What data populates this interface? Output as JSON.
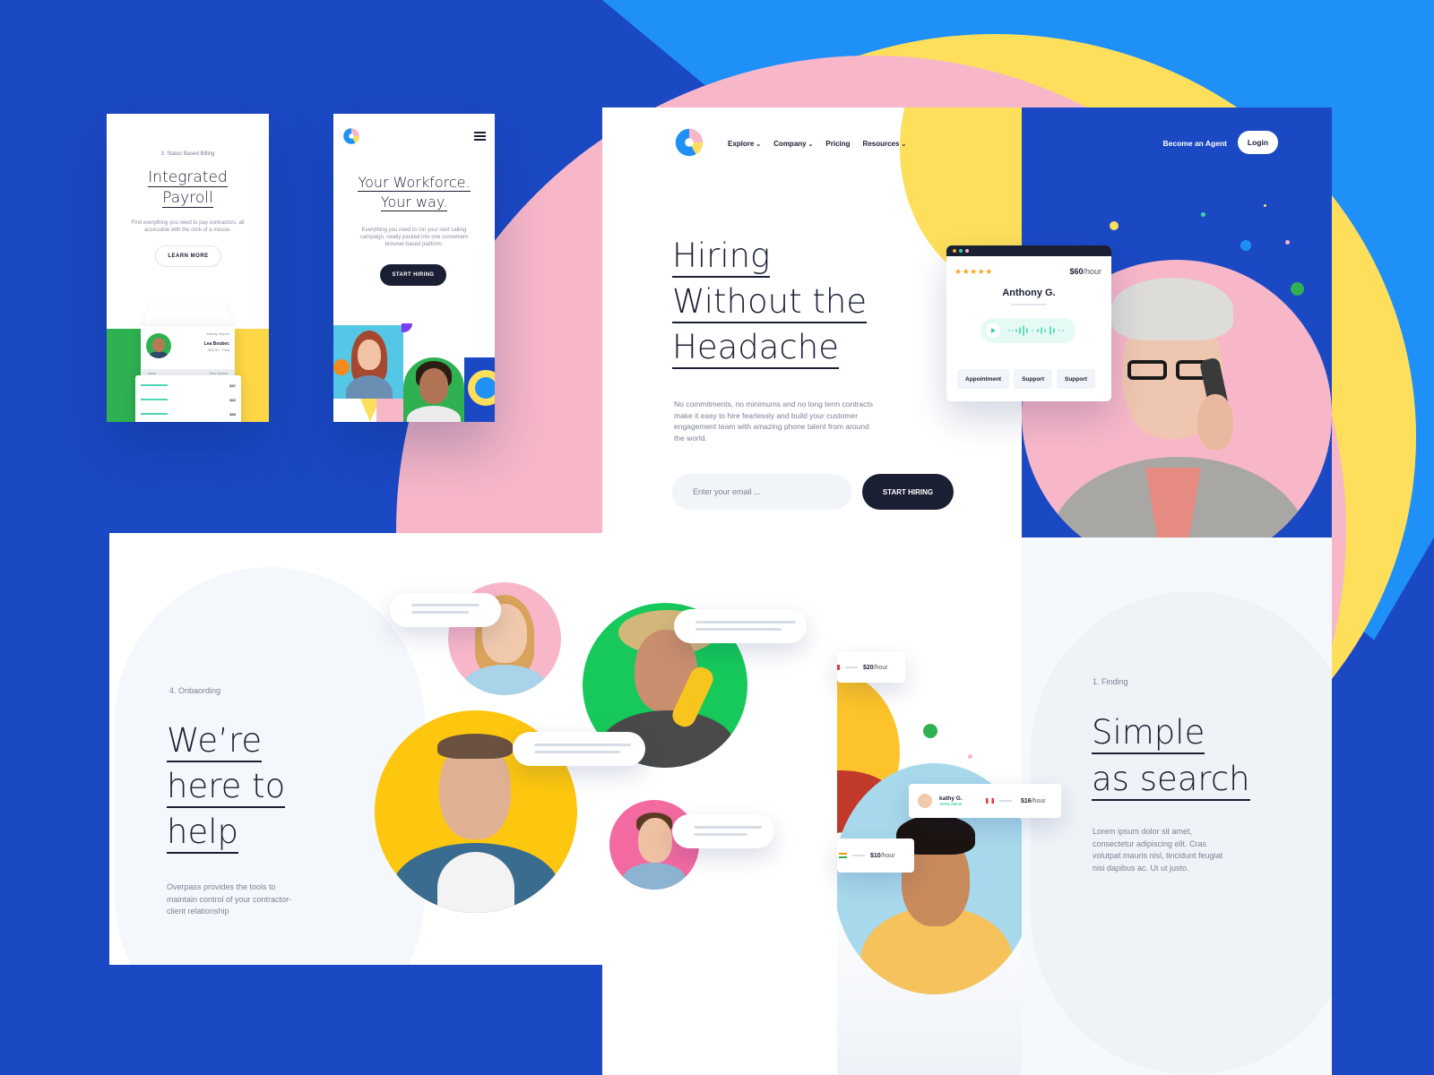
{
  "colors": {
    "brand_blue": "#1b49c4",
    "light_blue": "#1e88f5",
    "pink": "#f7b7c9",
    "yellow": "#fddf5b",
    "dark": "#1a1f33",
    "mint": "#3cd3a8"
  },
  "mobile_payroll": {
    "step": "3. Status Based Billing",
    "title_line1": "Integrated",
    "title_line2": "Payroll",
    "description": "Find everything you need to pay contractors, all accessible with the click of a mouse.",
    "button": "LEARN MORE",
    "report_title": "Activity Report",
    "report_name": "Lea Boubec",
    "report_sub": "$60.00 · Paid",
    "table_header_left": "Name",
    "table_header_right": "Time Worked",
    "table_rows": [
      "$37",
      "$22",
      "$39"
    ]
  },
  "mobile_workforce": {
    "logo": "brand-logo",
    "menu": "hamburger-icon",
    "title_line1": "Your Workforce.",
    "title_line2": "Your way.",
    "description": "Everything you need to run your next calling campaign, neatly packed into one convenient browser-based platform.",
    "button": "START HIRING"
  },
  "hero": {
    "nav": [
      {
        "label": "Explore",
        "dropdown": true
      },
      {
        "label": "Company",
        "dropdown": true
      },
      {
        "label": "Pricing",
        "dropdown": false
      },
      {
        "label": "Resources",
        "dropdown": true
      }
    ],
    "title_line1": "Hiring",
    "title_line2": "Without the",
    "title_line3": "Headache",
    "description": "No commitments, no minimums and no long term contracts make it easy to hire fearlessly and build your customer engagement team with amazing phone talent from around the world.",
    "email_placeholder": "Enter your email ...",
    "button": "START HIRING"
  },
  "header_right": {
    "become_agent": "Become an Agent",
    "login": "Login"
  },
  "agent_card": {
    "stars": "★★★★★",
    "rate": "$60",
    "rate_unit": "/hour",
    "name": "Anthony G.",
    "tags": [
      "Appointment",
      "Support",
      "Support"
    ]
  },
  "finding": {
    "step": "1. Finding",
    "title_line1": "Simple",
    "title_line2": "as search",
    "description": "Lorem ipsum dolor sit amet, consectetur adipiscing elit. Cras volutpat mauris nisl, tincidunt feugiat nisi dapibus ac. Ut ut justo."
  },
  "onboarding": {
    "step": "4. Onbaording",
    "title_line1": "We’re",
    "title_line2": "here to",
    "title_line3": "help",
    "description": "Overpass provides the tools to maintain control of your contractor-client relationship"
  },
  "rates": {
    "r1": "$20",
    "r2": "$16",
    "r3": "$10",
    "unit": "/hour",
    "kathy_name": "kathy G.",
    "kathy_status": "AVAILABLE"
  }
}
